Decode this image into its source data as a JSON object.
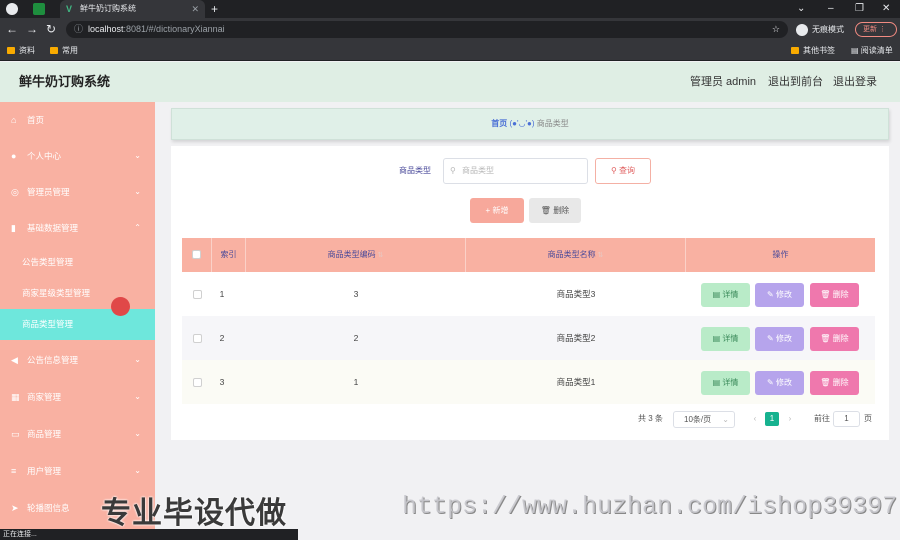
{
  "browser": {
    "tab_title": "鲜牛奶订购系统",
    "url_host": "localhost",
    "url_path": ":8081/#/dictionaryXiannai",
    "incognito_label": "无痕模式",
    "update_label": "更新",
    "bookmarks": [
      "资料",
      "常用"
    ],
    "bookmarks_right": [
      "其他书签",
      "阅读清单"
    ],
    "status_text": "正在连接..."
  },
  "header": {
    "title": "鲜牛奶订购系统",
    "user": "管理员 admin",
    "front_link": "退出到前台",
    "logout_link": "退出登录"
  },
  "sidebar": {
    "items": [
      {
        "label": "首页",
        "icon": "home-icon"
      },
      {
        "label": "个人中心",
        "icon": "user-icon"
      },
      {
        "label": "管理员管理",
        "icon": "admin-icon"
      },
      {
        "label": "基础数据管理",
        "icon": "chart-icon"
      }
    ],
    "sub_items": [
      "公告类型管理",
      "商家星级类型管理",
      "商品类型管理"
    ],
    "items_after": [
      {
        "label": "公告信息管理",
        "icon": "megaphone-icon"
      },
      {
        "label": "商家管理",
        "icon": "grid-icon"
      },
      {
        "label": "商品管理",
        "icon": "chat-icon"
      },
      {
        "label": "用户管理",
        "icon": "list-icon"
      },
      {
        "label": "轮播图信息",
        "icon": "send-icon"
      }
    ]
  },
  "breadcrumb": {
    "home": "首页",
    "emoticon": "(●'◡'●)",
    "current": "商品类型"
  },
  "search": {
    "label": "商品类型",
    "placeholder": "商品类型",
    "query_button": "查询"
  },
  "actions": {
    "add": "新增",
    "delete": "删除"
  },
  "table": {
    "headers": [
      "索引",
      "商品类型编码",
      "商品类型名称",
      "操作"
    ],
    "rows": [
      {
        "index": "1",
        "code": "3",
        "name": "商品类型3"
      },
      {
        "index": "2",
        "code": "2",
        "name": "商品类型2"
      },
      {
        "index": "3",
        "code": "1",
        "name": "商品类型1"
      }
    ],
    "row_actions": {
      "detail": "详情",
      "edit": "修改",
      "delete": "删除"
    }
  },
  "pagination": {
    "total": "共 3 条",
    "page_size": "10条/页",
    "current_page": "1",
    "goto_label": "前往",
    "goto_value": "1",
    "page_suffix": "页"
  },
  "watermark": {
    "left": "专业毕设代做",
    "right": "https://www.huzhan.com/ishop39397"
  },
  "colors": {
    "sidebar": "#f9b1a2",
    "header": "#dfeee4",
    "active_sub": "#6ee7dc",
    "table_header": "#f9b1a2",
    "detail_btn": "#b9ebc8",
    "edit_btn": "#b6a4ec",
    "delete_btn": "#ef78ad"
  }
}
